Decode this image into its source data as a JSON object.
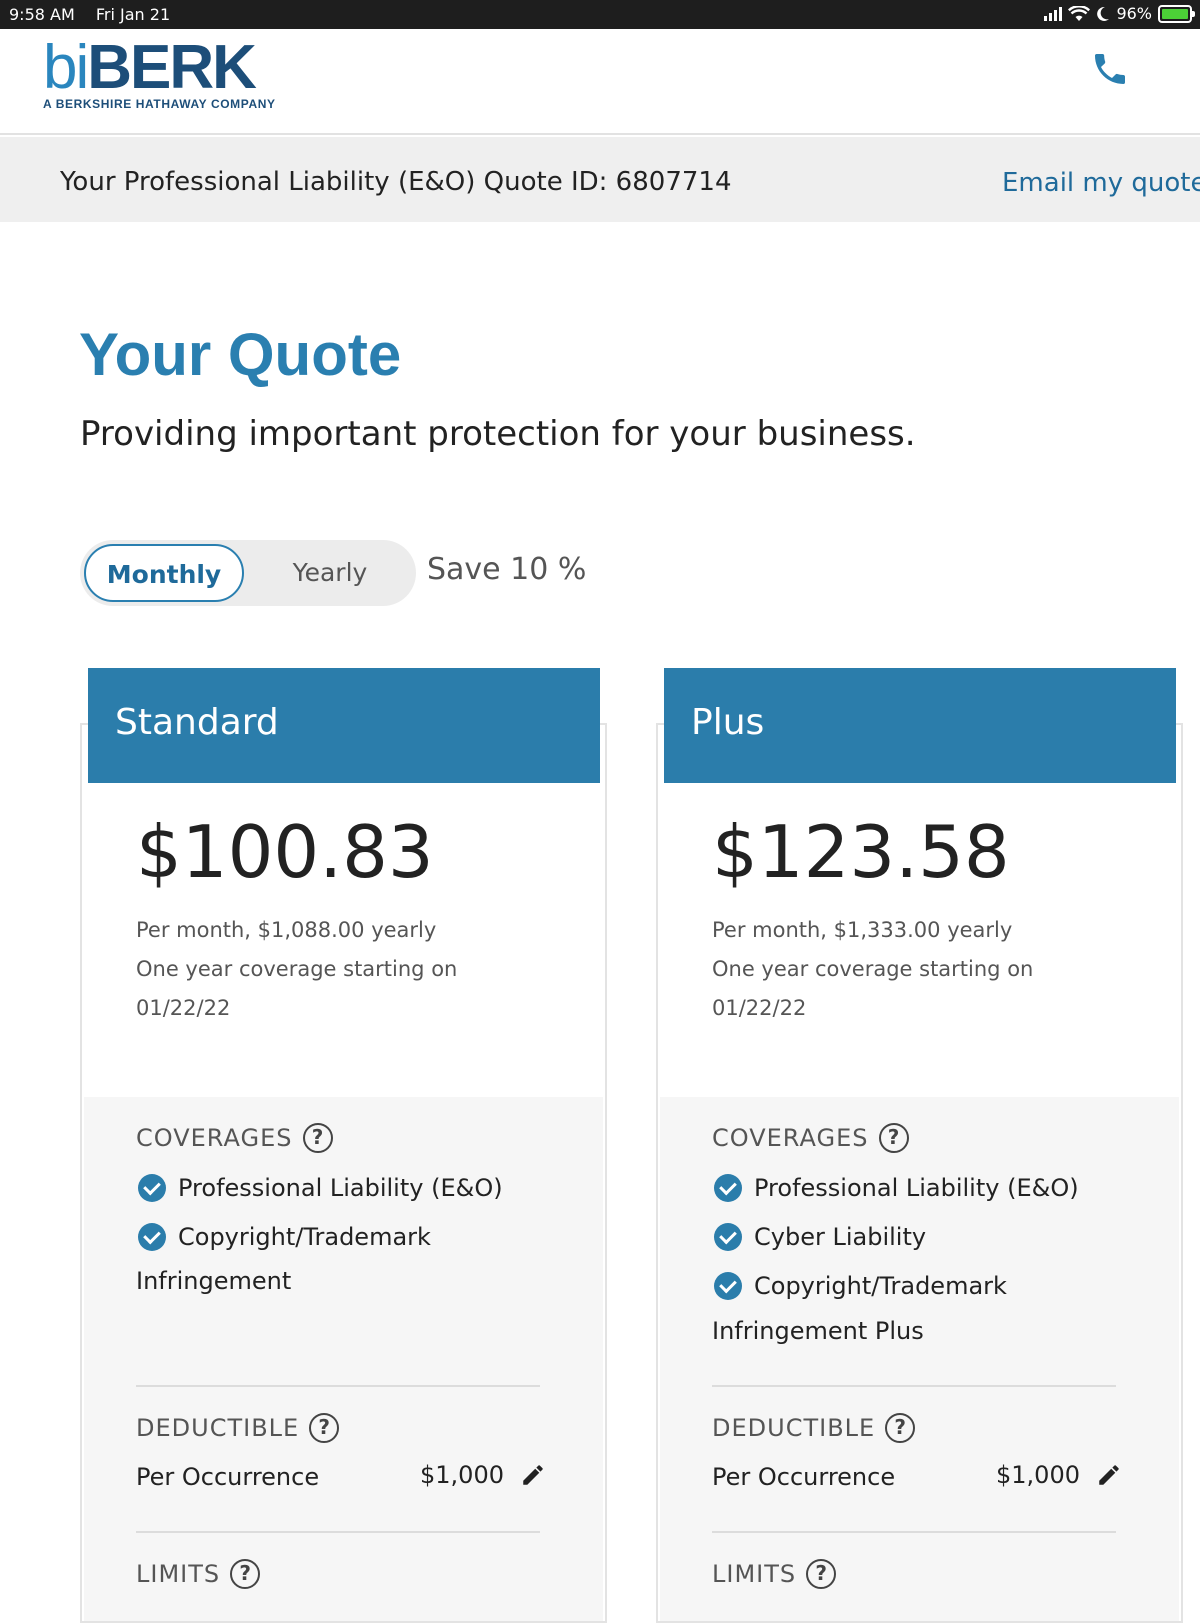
{
  "status_bar": {
    "time": "9:58 AM",
    "date": "Fri Jan 21",
    "battery": "96%",
    "battery_level": 0.96
  },
  "header": {
    "logo_bi": "bi",
    "logo_berk": "BERK",
    "logo_tagline": "A BERKSHIRE HATHAWAY COMPANY",
    "phone_icon": "phone-icon"
  },
  "quote_bar": {
    "quote_id_text": "Your Professional Liability (E&O) Quote ID: 6807714",
    "email_link": "Email my quote"
  },
  "main": {
    "title": "Your Quote",
    "subtitle": "Providing important protection for your business."
  },
  "billing_toggle": {
    "options": [
      "Monthly",
      "Yearly"
    ],
    "selected": "Monthly",
    "save_text": "Save 10 %"
  },
  "plans": [
    {
      "name": "Standard",
      "price": "$100.83",
      "price_detail": "Per month, $1,088.00 yearly",
      "coverage_line": "One year coverage starting on",
      "start_date": "01/22/22",
      "coverages_label": "COVERAGES",
      "coverages": [
        "Professional Liability (E&O)",
        "Copyright/Trademark"
      ],
      "coverage_wrap": "Infringement",
      "deductible_label": "DEDUCTIBLE",
      "deductible_name": "Per Occurrence",
      "deductible_value": "$1,000",
      "limits_label": "LIMITS"
    },
    {
      "name": "Plus",
      "price": "$123.58",
      "price_detail": "Per month, $1,333.00 yearly",
      "coverage_line": "One year coverage starting on",
      "start_date": "01/22/22",
      "coverages_label": "COVERAGES",
      "coverages": [
        "Professional Liability (E&O)",
        "Cyber Liability",
        "Copyright/Trademark"
      ],
      "coverage_wrap": "Infringement Plus",
      "deductible_label": "DEDUCTIBLE",
      "deductible_name": "Per Occurrence",
      "deductible_value": "$1,000",
      "limits_label": "LIMITS"
    }
  ],
  "colors": {
    "brand_blue": "#2b7dab",
    "brand_dark": "#1d4e79",
    "link": "#1f6a9a"
  }
}
